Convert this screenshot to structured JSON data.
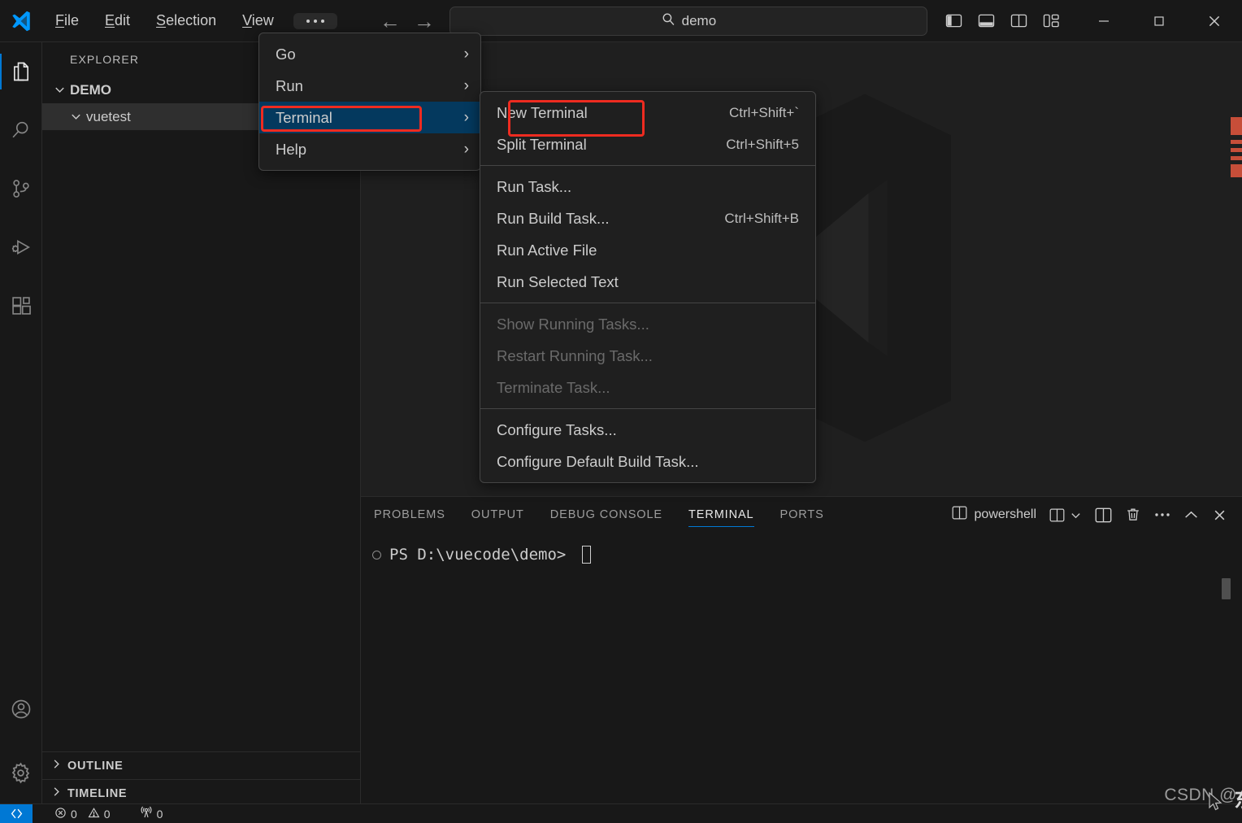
{
  "app": {
    "name": "Visual Studio Code",
    "logo_icon": "vscode-logo-icon"
  },
  "titlebar": {
    "menus": [
      {
        "label": "File",
        "mnemonic": "F"
      },
      {
        "label": "Edit",
        "mnemonic": "E"
      },
      {
        "label": "Selection",
        "mnemonic": "S"
      },
      {
        "label": "View",
        "mnemonic": "V"
      }
    ],
    "more_button": "...",
    "nav": {
      "back": "back-arrow-icon",
      "forward": "forward-arrow-icon"
    },
    "command_center": {
      "value": "demo",
      "placeholder": "Search",
      "icon": "search-icon"
    },
    "layout_buttons": [
      {
        "name": "toggle-primary-sidebar",
        "icon": "layout-sidebar-left-icon"
      },
      {
        "name": "toggle-panel",
        "icon": "layout-panel-icon"
      },
      {
        "name": "toggle-secondary-sidebar",
        "icon": "layout-sidebar-right-icon"
      },
      {
        "name": "customize-layout",
        "icon": "layout-customize-icon"
      }
    ],
    "window_controls": [
      {
        "name": "minimize-button",
        "glyph": "minimize-icon"
      },
      {
        "name": "maximize-button",
        "glyph": "maximize-icon"
      },
      {
        "name": "close-button",
        "glyph": "close-icon"
      }
    ]
  },
  "activitybar": {
    "items": [
      {
        "label": "Explorer",
        "icon": "files-icon",
        "active": true
      },
      {
        "label": "Search",
        "icon": "search-icon",
        "active": false
      },
      {
        "label": "Source Control",
        "icon": "source-control-icon",
        "active": false
      },
      {
        "label": "Run and Debug",
        "icon": "run-debug-icon",
        "active": false
      },
      {
        "label": "Extensions",
        "icon": "extensions-icon",
        "active": false
      }
    ],
    "bottom_items": [
      {
        "label": "Accounts",
        "icon": "account-icon"
      },
      {
        "label": "Manage",
        "icon": "gear-icon"
      }
    ]
  },
  "sidebar": {
    "title": "EXPLORER",
    "tree": [
      {
        "label": "DEMO",
        "level": "root",
        "expanded": true,
        "selected": false
      },
      {
        "label": "vuetest",
        "level": "child",
        "expanded": true,
        "selected": true
      }
    ],
    "sections": [
      {
        "label": "OUTLINE",
        "expanded": false
      },
      {
        "label": "TIMELINE",
        "expanded": false
      }
    ]
  },
  "menu_main": {
    "items": [
      {
        "label": "Go",
        "submenu": true,
        "disabled": false,
        "highlight": false
      },
      {
        "label": "Run",
        "submenu": true,
        "disabled": false,
        "highlight": false
      },
      {
        "label": "Terminal",
        "submenu": true,
        "disabled": false,
        "highlight": true
      },
      {
        "label": "Help",
        "submenu": true,
        "disabled": false,
        "highlight": false
      }
    ]
  },
  "menu_terminal": {
    "groups": [
      [
        {
          "label": "New Terminal",
          "shortcut": "Ctrl+Shift+`",
          "disabled": false,
          "annotated": true
        },
        {
          "label": "Split Terminal",
          "shortcut": "Ctrl+Shift+5",
          "disabled": false,
          "annotated": false
        }
      ],
      [
        {
          "label": "Run Task...",
          "shortcut": "",
          "disabled": false,
          "annotated": false
        },
        {
          "label": "Run Build Task...",
          "shortcut": "Ctrl+Shift+B",
          "disabled": false,
          "annotated": false
        },
        {
          "label": "Run Active File",
          "shortcut": "",
          "disabled": false,
          "annotated": false
        },
        {
          "label": "Run Selected Text",
          "shortcut": "",
          "disabled": false,
          "annotated": false
        }
      ],
      [
        {
          "label": "Show Running Tasks...",
          "shortcut": "",
          "disabled": true,
          "annotated": false
        },
        {
          "label": "Restart Running Task...",
          "shortcut": "",
          "disabled": true,
          "annotated": false
        },
        {
          "label": "Terminate Task...",
          "shortcut": "",
          "disabled": true,
          "annotated": false
        }
      ],
      [
        {
          "label": "Configure Tasks...",
          "shortcut": "",
          "disabled": false,
          "annotated": false
        },
        {
          "label": "Configure Default Build Task...",
          "shortcut": "",
          "disabled": false,
          "annotated": false
        }
      ]
    ]
  },
  "panel": {
    "tabs": [
      {
        "label": "PROBLEMS",
        "active": false
      },
      {
        "label": "OUTPUT",
        "active": false
      },
      {
        "label": "DEBUG CONSOLE",
        "active": false
      },
      {
        "label": "TERMINAL",
        "active": true
      },
      {
        "label": "PORTS",
        "active": false
      }
    ],
    "terminal_name": "powershell",
    "actions": [
      {
        "name": "split-terminal-dropdown",
        "icon": "split-editor-icon"
      },
      {
        "name": "launch-profile-dropdown",
        "icon": "chevron-down-icon"
      },
      {
        "name": "split-terminal-button",
        "icon": "split-editor-icon"
      },
      {
        "name": "kill-terminal-button",
        "icon": "trash-icon"
      },
      {
        "name": "panel-more-actions",
        "icon": "ellipsis-icon"
      },
      {
        "name": "maximize-panel-button",
        "icon": "chevron-up-icon"
      },
      {
        "name": "close-panel-button",
        "icon": "close-icon"
      }
    ]
  },
  "terminal": {
    "prompt": "PS D:\\vuecode\\demo>",
    "cursor": "block"
  },
  "statusbar": {
    "remote_icon": "remote-host-icon",
    "errors_icon": "error-icon",
    "errors": "0",
    "warnings_icon": "warning-icon",
    "warnings": "0",
    "ports_icon": "radio-tower-icon",
    "ports": "0"
  },
  "watermark": {
    "text": "CSDN @",
    "overlay": "东云雪陌城"
  },
  "colors": {
    "accent": "#0078d4",
    "menu_highlight": "#04395e",
    "annotation_red": "#ee2b20",
    "titlebar_bg": "#181818",
    "editor_bg": "#1f1f1f",
    "sidebar_bg": "#181818",
    "error_red": "#c74e39"
  }
}
